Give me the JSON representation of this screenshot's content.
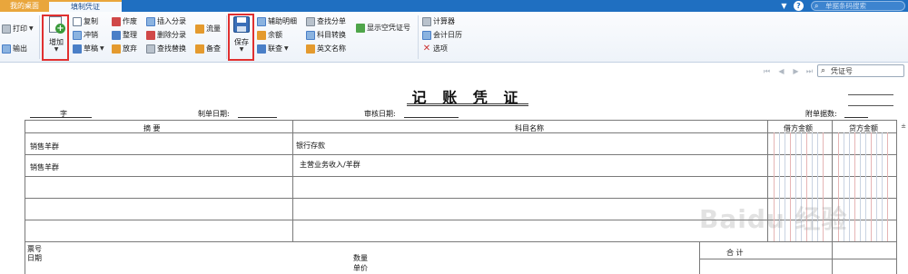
{
  "tabs": {
    "home": "我的桌面",
    "voucher": "填制凭证"
  },
  "titlebar": {
    "search_placeholder": "单据条码搜索",
    "help": "?"
  },
  "ribbon": {
    "print": "打印",
    "export": "输出",
    "add": "增加",
    "copy": "复制",
    "reverse": "冲销",
    "draft": "草稿",
    "void": "作废",
    "tidy": "整理",
    "abandon": "放弃",
    "insert_entry": "插入分录",
    "delete_entry": "删除分录",
    "find_replace": "查找替换",
    "cashflow": "流量",
    "memo": "备查",
    "save": "保存",
    "aux_detail": "辅助明细",
    "balance": "余额",
    "link_query": "联查",
    "find_entry": "查找分单",
    "subject_convert": "科目转换",
    "english_name": "英文名称",
    "show_empty_voucher": "显示空凭证号",
    "calculator": "计算器",
    "accounting_calendar": "会计日历",
    "options": "选项"
  },
  "nav": {
    "voucher_no_placeholder": "凭证号"
  },
  "voucher": {
    "title": "记 账 凭 证",
    "word_label": "字",
    "date_label": "制单日期:",
    "audit_date_label": "审核日期:",
    "attachments_label": "附单据数:",
    "columns": {
      "summary": "摘 要",
      "subject": "科目名称",
      "debit": "借方金额",
      "credit": "贷方金额"
    },
    "rows": [
      {
        "summary": "销售羊群",
        "subject": "银行存款"
      },
      {
        "summary": "销售羊群",
        "subject": "主营业务收入/羊群"
      },
      {
        "summary": "",
        "subject": ""
      },
      {
        "summary": "",
        "subject": ""
      },
      {
        "summary": "",
        "subject": ""
      }
    ],
    "footer": {
      "ticket_no": "票号",
      "date": "日期",
      "quantity": "数量",
      "unit_price": "单价",
      "total": "合 计"
    }
  },
  "watermark": {
    "text": "Baidu 经验"
  },
  "colors": {
    "titlebar": "#1f6fc1",
    "home_tab": "#e9a63c",
    "highlight": "#e03030"
  }
}
